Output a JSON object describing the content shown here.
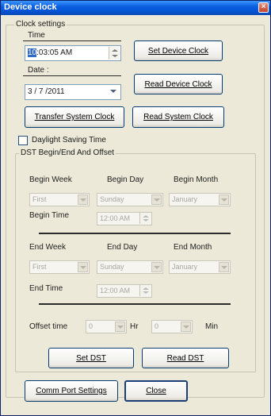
{
  "window": {
    "title": "Device clock",
    "close_glyph": "×"
  },
  "clock_settings": {
    "legend": "Clock settings",
    "time_label": "Time",
    "time_hour": "10",
    "time_rest": ":03:05 AM",
    "date_label": "Date :",
    "date_value": "3 / 7 /2011",
    "set_device_clock": "Set Device Clock",
    "read_device_clock": "Read Device Clock",
    "transfer_system_clock": "Transfer System Clock",
    "read_system_clock": "Read System Clock",
    "daylight_saving_label": "Daylight Saving Time",
    "daylight_saving_checked": false
  },
  "dst": {
    "legend": "DST Begin/End And Offset",
    "begin_week_label": "Begin Week",
    "begin_day_label": "Begin Day",
    "begin_month_label": "Begin Month",
    "begin_week_value": "First",
    "begin_day_value": "Sunday",
    "begin_month_value": "January",
    "begin_time_label": "Begin Time",
    "begin_time_value": "12:00 AM",
    "end_week_label": "End Week",
    "end_day_label": "End Day",
    "end_month_label": "End Month",
    "end_week_value": "First",
    "end_day_value": "Sunday",
    "end_month_value": "January",
    "end_time_label": "End Time",
    "end_time_value": "12:00 AM",
    "offset_label": "Offset time",
    "offset_hr_value": "0",
    "hr_label": "Hr",
    "offset_min_value": "0",
    "min_label": "Min",
    "set_dst": "Set DST",
    "read_dst": "Read DST"
  },
  "footer": {
    "comm_port_settings": "Comm Port Settings",
    "close": "Close"
  }
}
